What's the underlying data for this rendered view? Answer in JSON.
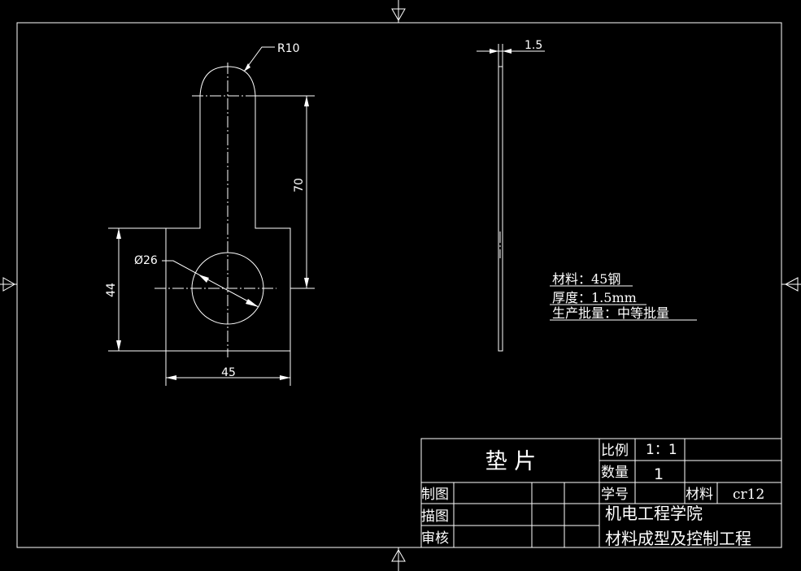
{
  "dimensions": {
    "radius": "R10",
    "thickness": "1.5",
    "height_top": "70",
    "height_block": "44",
    "hole_diameter": "Ø26",
    "width_block": "45"
  },
  "notes": {
    "material": "材料：45钢",
    "thickness": "厚度：1.5mm",
    "batch": "生产批量：中等批量"
  },
  "title_block": {
    "part_name": "垫 片",
    "scale_label": "比例",
    "scale_value": "1：1",
    "quantity_label": "数量",
    "quantity_value": "1",
    "drawn_label": "制图",
    "traced_label": "描图",
    "checked_label": "审核",
    "student_id_label": "学号",
    "material_label": "材料",
    "material_value": "cr12",
    "school": "机电工程学院",
    "department": "材料成型及控制工程"
  }
}
